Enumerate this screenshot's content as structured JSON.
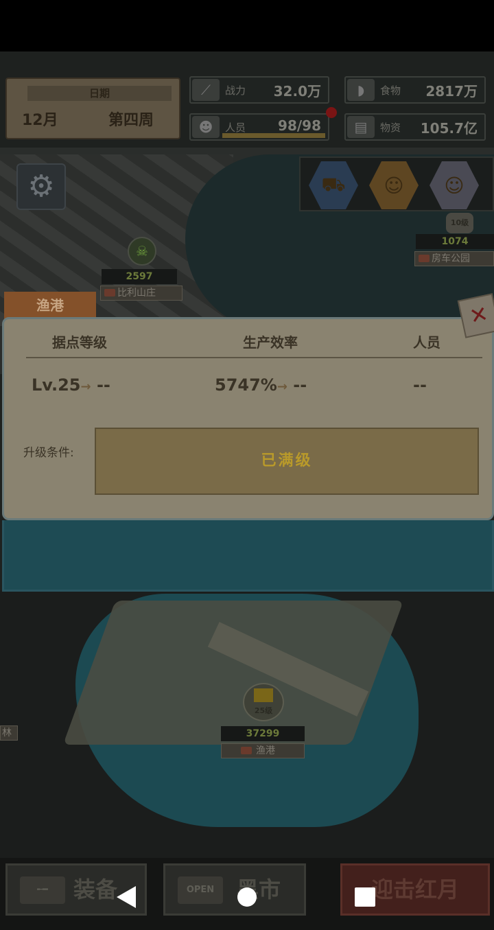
{
  "hud": {
    "date_label": "日期",
    "month": "12月",
    "week": "第四周",
    "power": {
      "label": "战力",
      "value": "32.0万"
    },
    "food": {
      "label": "食物",
      "value": "2817万"
    },
    "people": {
      "label": "人员",
      "value": "98/98"
    },
    "supplies": {
      "label": "物资",
      "value": "105.7亿"
    }
  },
  "map": {
    "markers": [
      {
        "count": "2597",
        "name": "比利山庄"
      },
      {
        "count": "1074",
        "name": "房车公园",
        "level": "10级"
      },
      {
        "count": "37299",
        "name": "渔港",
        "level": "25级"
      }
    ],
    "left_edge_label": "林"
  },
  "panel": {
    "tab_title": "渔港",
    "headers": {
      "level": "据点等级",
      "efficiency": "生产效率",
      "staff": "人员"
    },
    "values": {
      "level": "Lv.25",
      "level_next": "--",
      "efficiency": "5747%",
      "efficiency_next": "--",
      "staff": "--"
    },
    "arrow": "→",
    "condition_label": "升级条件:",
    "max_level_text": "已满级",
    "close_symbol": "✕"
  },
  "bottom": {
    "equip_label": "装备",
    "market_label": "黑市",
    "market_sign": "OPEN",
    "red_moon_label": "迎击红月"
  },
  "colors": {
    "max_text": "#b99a2a",
    "panel_bg": "#8a8370",
    "tab_bg": "#84512a"
  }
}
